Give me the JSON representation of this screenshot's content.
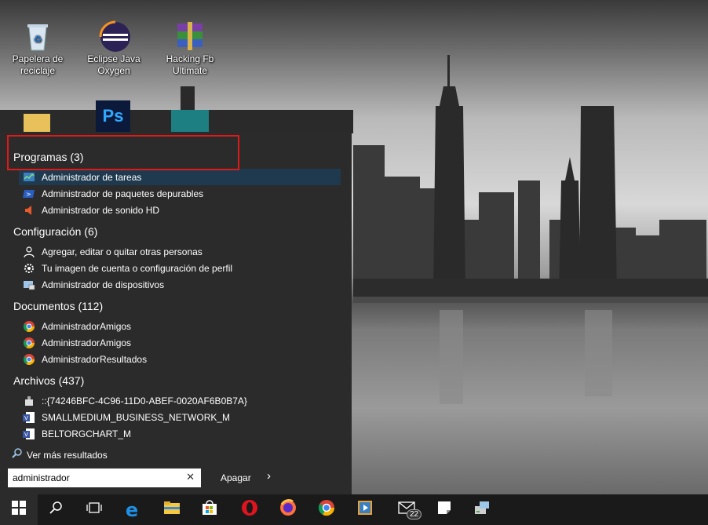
{
  "desktop": {
    "icons": [
      {
        "label": "Papelera de reciclaje",
        "icon": "recycle-bin-icon"
      },
      {
        "label": "Eclipse Java Oxygen",
        "icon": "eclipse-icon"
      },
      {
        "label": "Hacking Fb Ultimate",
        "icon": "winrar-icon"
      }
    ]
  },
  "search_panel": {
    "programas": {
      "title": "Programas (3)",
      "items": [
        {
          "label": "Administrador de tareas",
          "icon": "task-manager-icon"
        },
        {
          "label": "Administrador de paquetes depurables",
          "icon": "powershell-icon"
        },
        {
          "label": "Administrador de sonido HD",
          "icon": "speaker-icon"
        }
      ]
    },
    "configuracion": {
      "title": "Configuración (6)",
      "items": [
        {
          "label": "Agregar, editar o quitar otras personas",
          "icon": "person-icon"
        },
        {
          "label": "Tu imagen de cuenta o configuración de perfil",
          "icon": "gear-icon"
        },
        {
          "label": "Administrador de dispositivos",
          "icon": "device-manager-icon"
        }
      ]
    },
    "documentos": {
      "title": "Documentos (112)",
      "items": [
        {
          "label": "AdministradorAmigos",
          "icon": "chrome-icon"
        },
        {
          "label": "AdministradorAmigos",
          "icon": "chrome-icon"
        },
        {
          "label": "AdministradorResultados",
          "icon": "chrome-icon"
        }
      ]
    },
    "archivos": {
      "title": "Archivos (437)",
      "items": [
        {
          "label": "::{74246BFC-4C96-11D0-ABEF-0020AF6B0B7A}",
          "icon": "device-icon"
        },
        {
          "label": "SMALLMEDIUM_BUSINESS_NETWORK_M",
          "icon": "visio-icon"
        },
        {
          "label": "BELTORGCHART_M",
          "icon": "visio-icon"
        }
      ]
    },
    "more_results": "Ver más resultados",
    "search_value": "administrador",
    "open_label": "Apagar"
  },
  "taskbar": {
    "mail_badge": "22",
    "icons": [
      "windows-start-icon",
      "search-icon",
      "task-view-icon",
      "edge-icon",
      "file-explorer-icon",
      "store-icon",
      "opera-icon",
      "firefox-icon",
      "chrome-icon",
      "media-player-icon",
      "mail-icon",
      "sticky-notes-icon",
      "network-icon"
    ]
  },
  "colors": {
    "panel_bg": "#2b2b2b",
    "selected_bg": "#1f3a4f",
    "highlight_red": "#e01919",
    "taskbar_bg": "#1a1a1a"
  }
}
